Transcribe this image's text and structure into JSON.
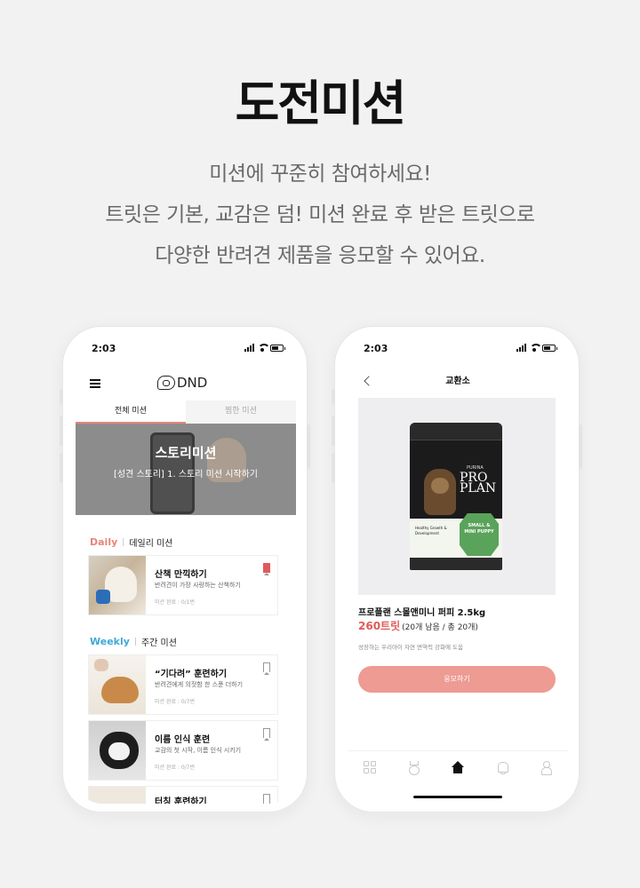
{
  "hero": {
    "title": "도전미션",
    "lines": [
      "미션에 꾸준히 참여하세요!",
      "트릿은 기본, 교감은 덤! 미션 완료 후 받은 트릿으로",
      "다양한 반려견 제품을 응모할 수 있어요."
    ]
  },
  "left_phone": {
    "status_time": "2:03",
    "logo_text": "DND",
    "tabs": [
      {
        "label": "전체 미션",
        "active": true
      },
      {
        "label": "찜한 미션",
        "active": false
      }
    ],
    "banner": {
      "title": "스토리미션",
      "subtitle": "[성견 스토리] 1. 스토리 미션 시작하기"
    },
    "daily": {
      "tag": "Daily",
      "label": "데일리 미션",
      "tag_color": "#e8847a",
      "cards": [
        {
          "title": "산책 만끽하기",
          "desc": "반려견이 가장 사랑하는 산책하기",
          "meta": "미션 완료 : 0/1번",
          "bookmarked": true
        }
      ]
    },
    "weekly": {
      "tag": "Weekly",
      "label": "주간 미션",
      "tag_color": "#3fa9d6",
      "cards": [
        {
          "title": "“기다려” 훈련하기",
          "desc": "반려견에게 의젓함 한 스푼 더하기",
          "meta": "미션 완료 : 0/7번",
          "bookmarked": false
        },
        {
          "title": "이름 인식 훈련",
          "desc": "교감의 첫 시작, 이름 인식 시키기",
          "meta": "미션 완료 : 0/7번",
          "bookmarked": false
        },
        {
          "title": "터칭 훈련하기",
          "desc": "",
          "meta": "",
          "bookmarked": false
        }
      ]
    }
  },
  "right_phone": {
    "status_time": "2:03",
    "title": "교환소",
    "product": {
      "bag_brand": "PURINA",
      "bag_line1": "PRO",
      "bag_line2": "PLAN",
      "bag_badge": "SMALL & MINI PUPPY",
      "bag_health": "Healthy Growth & Development",
      "name": "프로플랜 스몰앤미니 퍼피 2.5kg",
      "price": "260트릿",
      "stock": "(20개 남음 / 총 20개)",
      "desc": "성장하는 우리아이 자연 면역력 강화에 도움"
    },
    "apply_label": "응모하기",
    "nav": [
      "grid-icon",
      "medal-icon",
      "home-icon",
      "bell-icon",
      "user-icon"
    ],
    "accent": "#ed9b93",
    "price_color": "#e15a5a"
  }
}
